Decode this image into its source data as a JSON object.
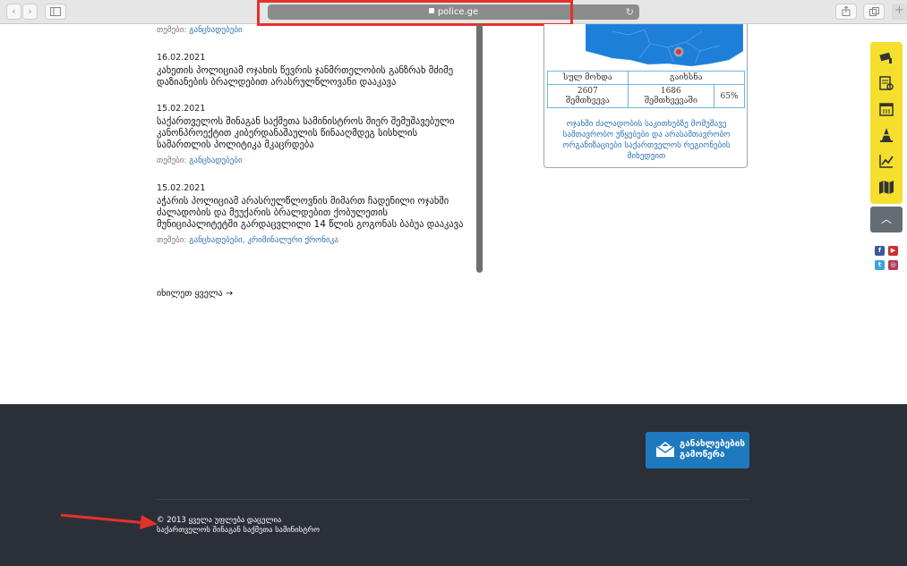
{
  "browser": {
    "url": "police.ge"
  },
  "news": [
    {
      "date": "",
      "headline": "",
      "themes_label": "თემები:",
      "themes": "განცხადებები"
    },
    {
      "date": "16.02.2021",
      "headline": "კახეთის პოლიციამ ოჯახის წევრის ჯანმრთელობის განზრახ მძიმე დაზიანების ბრალდებით არასრულწლოვანი დააკავა",
      "themes_label": "",
      "themes": ""
    },
    {
      "date": "15.02.2021",
      "headline": "საქართველოს შინაგან საქმეთა სამინისტროს მიერ შემუშავებული კანონპროექტით კიბერდანაშაულის წინააღმდეგ სისხლის სამართლის პოლიტიკა მკაცრდება",
      "themes_label": "თემები:",
      "themes": "განცხადებები"
    },
    {
      "date": "15.02.2021",
      "headline": "აჭარის პოლიციამ არასრულწლოვნის მიმართ ჩადენილი ოჯახში ძალადობის და მეუქარის ბრალდებით ქობულეთის მუნიციპალიტეტში გარდაცვლილი 14 წლის გოგონას ბაბუა დააკავა",
      "themes_label": "თემები:",
      "themes": "განცხადებები, კრიმინალური ქრონიკა"
    }
  ],
  "see_all": "იხილეთ ყველა →",
  "stats": {
    "header_total": "სულ მოხდა",
    "header_solved": "გაიხსნა",
    "total_value": "2607",
    "total_unit": "შემთხვევა",
    "solved_value": "1686",
    "solved_unit": "შემთხვევაში",
    "percent": "65%"
  },
  "map_link": "ოჯახში ძალადობის საკითხებზე მომუშავე სამთავრობო უწყებები და არასამთავრობო ორგანიზაციები საქართველოს რეგიონების მიხედვით",
  "side_icons": [
    "camera-icon",
    "document-search-icon",
    "calendar-icon",
    "traffic-cone-icon",
    "chart-icon",
    "map-icon"
  ],
  "social": [
    {
      "name": "facebook-icon",
      "glyph": "f",
      "color": "#3b5998"
    },
    {
      "name": "youtube-icon",
      "glyph": "▶",
      "color": "#cc2d2d"
    },
    {
      "name": "twitter-icon",
      "glyph": "t",
      "color": "#3aa3de"
    },
    {
      "name": "instagram-icon",
      "glyph": "◎",
      "color": "#b53a5a"
    }
  ],
  "footer": {
    "button_label": "განახლებების გამოწერა",
    "copyright_line1": "© 2013 ყველა უფლება დაცულია",
    "copyright_line2": "საქართველოს შინაგან საქმეთა სამინისტრო"
  },
  "colors": {
    "accent_blue": "#1f79bf",
    "highlight_red": "#e5312b",
    "side_yellow": "#f4df2e",
    "footer_bg": "#2b3038"
  }
}
